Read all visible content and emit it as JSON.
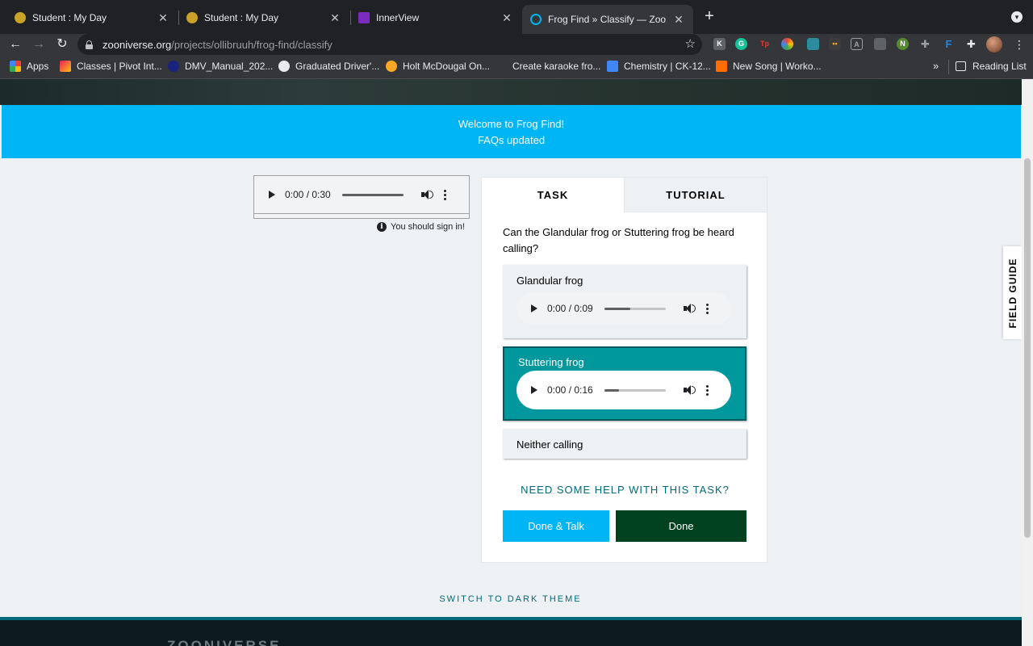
{
  "browser": {
    "tabs": [
      {
        "title": "Student : My Day",
        "favicon": "owl-icon",
        "color": "#c9a227"
      },
      {
        "title": "Student : My Day",
        "favicon": "owl-icon",
        "color": "#c9a227"
      },
      {
        "title": "InnerView",
        "favicon": "innerview-icon",
        "color": "#7b2cbf"
      },
      {
        "title": "Frog Find » Classify — Zooniverse",
        "favicon": "zooniverse-icon",
        "color": "#00b5f4"
      }
    ],
    "url_host": "zooniverse.org",
    "url_path": "/projects/ollibruuh/frog-find/classify",
    "bookmarks": [
      {
        "label": "Apps",
        "icon": "apps-grid-icon",
        "color": "#ea4335"
      },
      {
        "label": "Classes | Pivot Int...",
        "icon": "pivot-icon",
        "color": "#e91e63"
      },
      {
        "label": "DMV_Manual_202...",
        "icon": "d-icon",
        "color": "#1a237e"
      },
      {
        "label": "Graduated Driver'...",
        "icon": "globe-icon",
        "color": "#e8eaed"
      },
      {
        "label": "Holt McDougal On...",
        "icon": "holt-icon",
        "color": "#f9a825"
      },
      {
        "label": "Create karaoke fro...",
        "icon": "karaoke-icon",
        "color": "#35363a"
      },
      {
        "label": "Chemistry | CK-12...",
        "icon": "ck12-icon",
        "color": "#4285f4"
      },
      {
        "label": "New Song | Worko...",
        "icon": "song-icon",
        "color": "#ff6d00"
      }
    ],
    "reading_list": "Reading List",
    "more": "»"
  },
  "banner": {
    "line1": "Welcome to Frog Find!",
    "line2": "FAQs updated"
  },
  "subject_audio": {
    "time": "0:00 / 0:30",
    "progress": 1.0
  },
  "signin_notice": "You should sign in!",
  "task": {
    "tabs": [
      "TASK",
      "TUTORIAL"
    ],
    "question": "Can the Glandular frog or Stuttering frog be heard calling?",
    "answers": [
      {
        "label": "Glandular frog",
        "time": "0:00 / 0:09",
        "progress": 0.42,
        "selected": false
      },
      {
        "label": "Stuttering frog",
        "time": "0:00 / 0:16",
        "progress": 0.24,
        "selected": true
      },
      {
        "label": "Neither calling",
        "selected": false
      }
    ],
    "help_link": "NEED SOME HELP WITH THIS TASK?",
    "done_talk": "Done & Talk",
    "done": "Done"
  },
  "dark_theme": "SWITCH TO DARK THEME",
  "field_guide": "FIELD GUIDE",
  "footer_logo": "ZOONIVERSE",
  "colors": {
    "banner": "#00b5f4",
    "selected_answer": "#00979d",
    "done_button": "#00411f",
    "link": "#00697a"
  }
}
